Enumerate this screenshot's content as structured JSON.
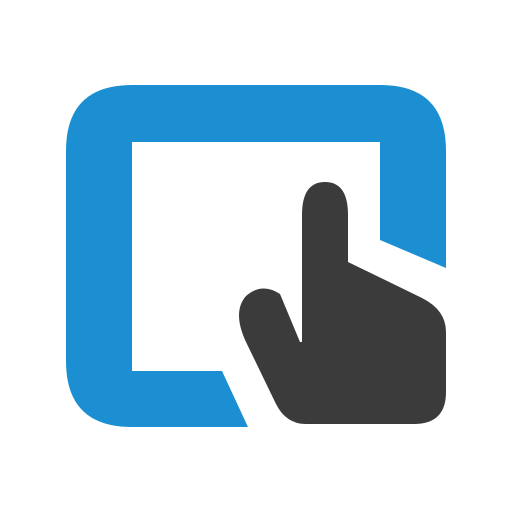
{
  "logo": {
    "icon": "touch-screen-hand-icon",
    "colors": {
      "background": "#ffffff",
      "frame_blue": "#1b8fd1",
      "hand_dark": "#3b3b3b"
    }
  }
}
